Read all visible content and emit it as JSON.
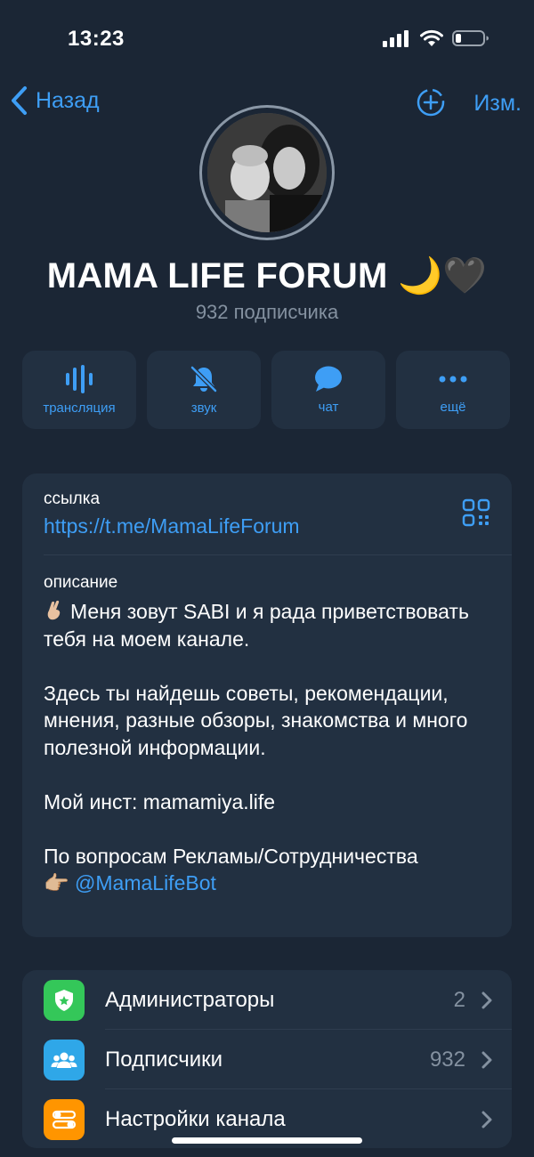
{
  "status": {
    "time": "13:23"
  },
  "nav": {
    "back_label": "Назад",
    "edit_label": "Изм."
  },
  "channel": {
    "title": "MAMA LIFE FORUM 🌙🖤",
    "subscribers_text": "932 подписчика"
  },
  "actions": [
    {
      "label": "трансляция",
      "icon": "broadcast-icon"
    },
    {
      "label": "звук",
      "icon": "bell-muted-icon"
    },
    {
      "label": "чат",
      "icon": "chat-bubble-icon"
    },
    {
      "label": "ещё",
      "icon": "more-dots-icon"
    }
  ],
  "info": {
    "link_label": "ссылка",
    "link_url": "https://t.me/MamaLifeForum",
    "description_label": "описание",
    "description_p1": "Меня зовут SABI и я рада приветствовать тебя на моем канале.",
    "description_p2": "Здесь ты найдешь советы, рекомендации, мнения, разные обзоры, знакомства и много полезной информации.",
    "description_p3": "Мой инст: mamamiya.life",
    "description_p4": "По вопросам Рекламы/Сотрудничества",
    "description_p4_emoji": "👉🏼",
    "mention": "@MamaLifeBot"
  },
  "menu": [
    {
      "label": "Администраторы",
      "value": "2",
      "icon": "shield-badge-icon",
      "color": "#34c759"
    },
    {
      "label": "Подписчики",
      "value": "932",
      "icon": "people-icon",
      "color": "#2fa7e8"
    },
    {
      "label": "Настройки канала",
      "value": "",
      "icon": "toggles-icon",
      "color": "#ff9500"
    }
  ],
  "colors": {
    "accent": "#3e9ef5",
    "background": "#1b2635",
    "card": "#223041",
    "muted": "#8491a0"
  }
}
